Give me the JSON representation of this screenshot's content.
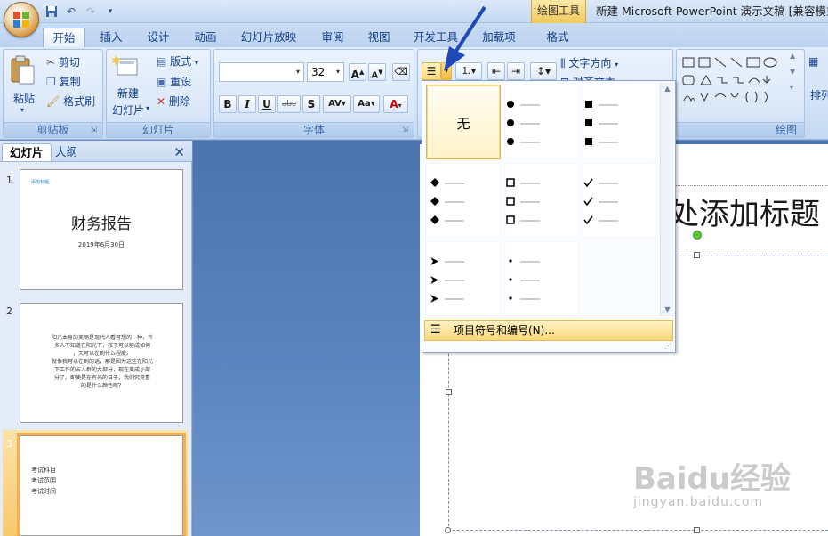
{
  "window": {
    "contextual_tab": "绘图工具",
    "title": "新建 Microsoft PowerPoint 演示文稿 [兼容模式"
  },
  "qat": {
    "icons": [
      "save-icon",
      "undo-icon",
      "redo-icon",
      "customize-icon"
    ]
  },
  "tabs": [
    {
      "label": "开始"
    },
    {
      "label": "插入"
    },
    {
      "label": "设计"
    },
    {
      "label": "动画"
    },
    {
      "label": "幻灯片放映"
    },
    {
      "label": "审阅"
    },
    {
      "label": "视图"
    },
    {
      "label": "开发工具"
    },
    {
      "label": "加载项"
    },
    {
      "label": "格式"
    }
  ],
  "ribbon": {
    "clipboard": {
      "label": "剪贴板",
      "paste": "粘贴",
      "cut": "剪切",
      "copy": "复制",
      "format_painter": "格式刷"
    },
    "slides": {
      "label": "幻灯片",
      "new_slide": "新建",
      "new_slide2": "幻灯片",
      "layout": "版式",
      "reset": "重设",
      "delete": "删除"
    },
    "font": {
      "label": "字体",
      "font_name": "",
      "font_size": "32"
    },
    "paragraph": {
      "text_direction": "文字方向",
      "align_text": "对齐文本"
    },
    "drawing": {
      "label": "绘图",
      "arrange": "排列"
    }
  },
  "pane": {
    "tabs": [
      "幻灯片",
      "大纲"
    ],
    "slides": [
      {
        "num": "1",
        "small": "添加标题",
        "title": "财务报告",
        "date": "2019年6月30日"
      },
      {
        "num": "2",
        "lines": [
          "阳光本身的美丽是现代人看可想的一种，许",
          "多人不知道在阳光下，孩子可以够成如何",
          "，天可以在到什么程度。",
          "就像我可以在到的话，那是因为这些在阳光",
          "下工作的占人群的大部分，现在变成小部",
          "分了。即使是在有光的日子，我们究竟看",
          "的是什么颜色呢？"
        ]
      },
      {
        "num": "3",
        "lines": [
          "考试科目",
          "考试范围",
          "考试时间"
        ]
      }
    ]
  },
  "slide": {
    "title": "处添加标题"
  },
  "dropdown": {
    "none_label": "无",
    "footer": "项目符号和编号(N)..."
  },
  "watermark": {
    "brand": "Baidu经验",
    "url": "jingyan.baidu.com"
  }
}
